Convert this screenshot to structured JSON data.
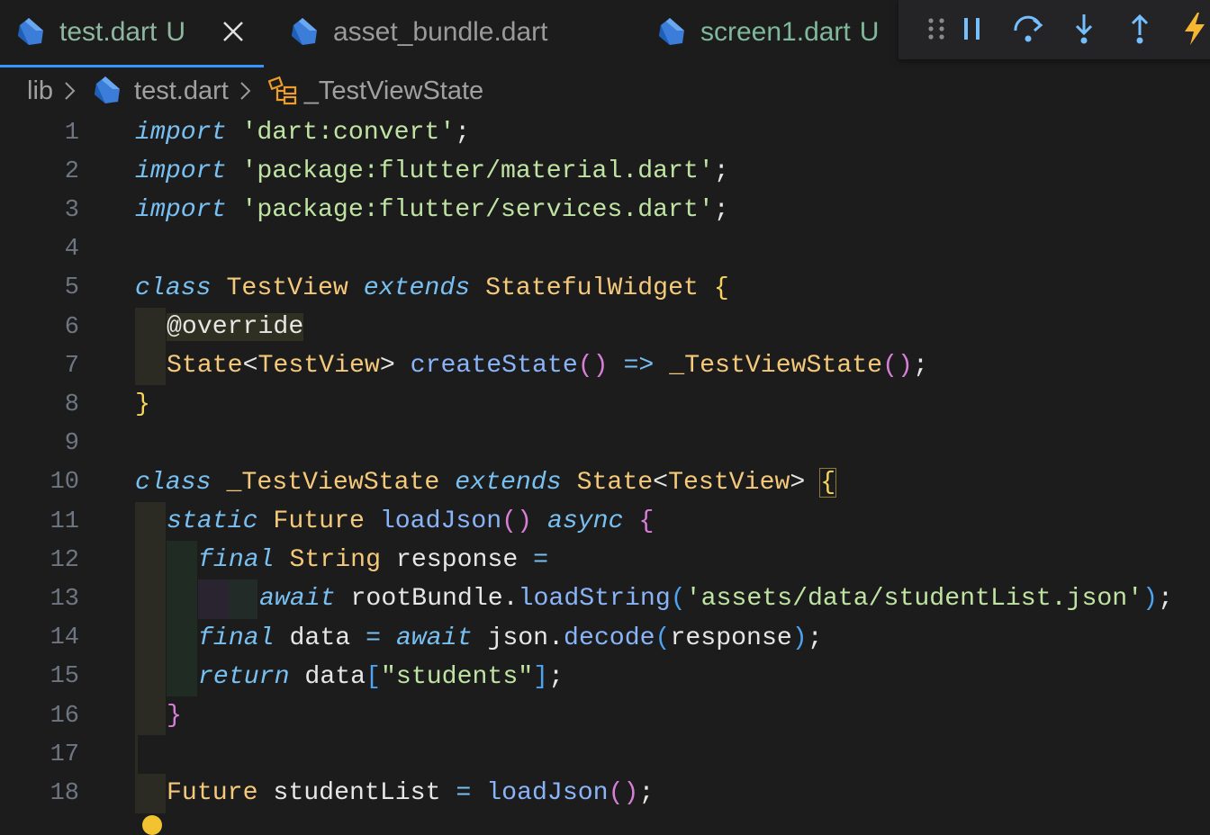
{
  "tabs": [
    {
      "label": "test.dart",
      "modified": "U",
      "active": true
    },
    {
      "label": "asset_bundle.dart",
      "modified": "",
      "active": false
    },
    {
      "label": "screen1.dart",
      "modified": "U",
      "active": false
    }
  ],
  "debug_toolbar": {
    "buttons": [
      "drag-handle-icon",
      "pause-icon",
      "step-over-icon",
      "step-into-icon",
      "step-out-icon",
      "hot-reload-icon"
    ]
  },
  "breadcrumb": {
    "folder": "lib",
    "file": "test.dart",
    "symbol": "_TestViewState"
  },
  "code": {
    "line_numbers": [
      "1",
      "2",
      "3",
      "4",
      "5",
      "6",
      "7",
      "8",
      "9",
      "10",
      "11",
      "12",
      "13",
      "14",
      "15",
      "16",
      "17",
      "18"
    ],
    "l1": {
      "kw": "import",
      "str": "'dart:convert'",
      "end": ";"
    },
    "l2": {
      "kw": "import",
      "str": "'package:flutter/material.dart'",
      "end": ";"
    },
    "l3": {
      "kw": "import",
      "str": "'package:flutter/services.dart'",
      "end": ";"
    },
    "l5": {
      "kw1": "class",
      "name": "TestView",
      "kw2": "extends",
      "base": "StatefulWidget",
      "brace": "{"
    },
    "l6": {
      "ann": "@override"
    },
    "l7": {
      "type": "State",
      "lt": "<",
      "gen": "TestView",
      "gt": ">",
      "fn": "createState",
      "paren": "()",
      "arrow": "=>",
      "ctor": "_TestViewState",
      "paren2": "()",
      "end": ";"
    },
    "l8": {
      "brace": "}"
    },
    "l10": {
      "kw1": "class",
      "name": "_TestViewState",
      "kw2": "extends",
      "base": "State",
      "lt": "<",
      "gen": "TestView",
      "gt": ">",
      "brace": "{"
    },
    "l11": {
      "kw1": "static",
      "type": "Future",
      "fn": "loadJson",
      "paren": "()",
      "kw2": "async",
      "brace": "{"
    },
    "l12": {
      "kw": "final",
      "type": "String",
      "var": "response",
      "eq": "="
    },
    "l13": {
      "kw": "await",
      "obj": "rootBundle",
      "dot": ".",
      "fn": "loadString",
      "open": "(",
      "str": "'assets/data/studentList.json'",
      "close": ")",
      "end": ";"
    },
    "l14": {
      "kw1": "final",
      "var": "data",
      "eq": "=",
      "kw2": "await",
      "obj": "json",
      "dot": ".",
      "fn": "decode",
      "open": "(",
      "arg": "response",
      "close": ")",
      "end": ";"
    },
    "l15": {
      "kw": "return",
      "var": "data",
      "open": "[",
      "str": "\"students\"",
      "close": "]",
      "end": ";"
    },
    "l16": {
      "brace": "}"
    },
    "l18": {
      "type": "Future",
      "var": "studentList",
      "eq": "=",
      "fn": "loadJson",
      "paren": "()",
      "end": ";"
    }
  }
}
